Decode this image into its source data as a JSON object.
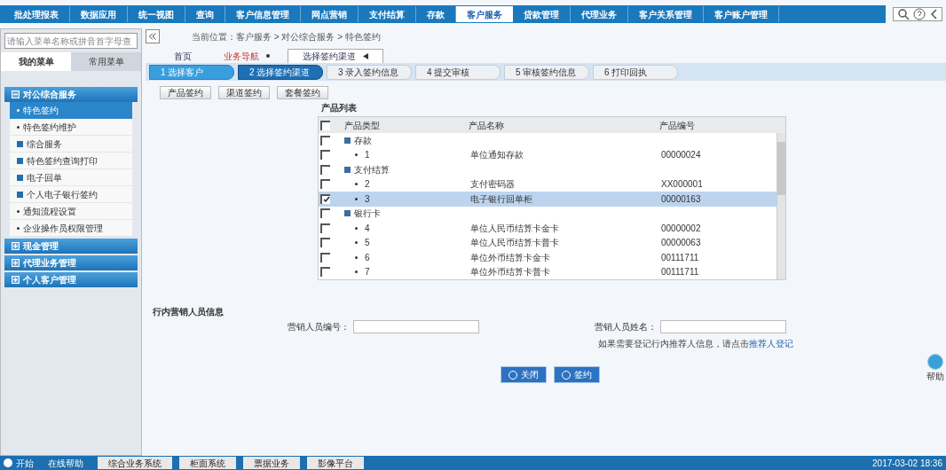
{
  "top_nav": [
    {
      "label": "批处理报表",
      "selected": false
    },
    {
      "label": "数据应用",
      "selected": false
    },
    {
      "label": "统一视图",
      "selected": false
    },
    {
      "label": "查询",
      "selected": false
    },
    {
      "label": "客户信息管理",
      "selected": false
    },
    {
      "label": "网点营销",
      "selected": false
    },
    {
      "label": "支付结算",
      "selected": false
    },
    {
      "label": "存款",
      "selected": false
    },
    {
      "label": "客户服务",
      "selected": true
    },
    {
      "label": "贷款管理",
      "selected": false
    },
    {
      "label": "代理业务",
      "selected": false
    },
    {
      "label": "客户关系管理",
      "selected": false
    },
    {
      "label": "客户账户管理",
      "selected": false
    }
  ],
  "sidebar": {
    "search_placeholder": "请输入菜单名称或拼音首字母查",
    "tabs": [
      {
        "label": "我的菜单",
        "selected": true
      },
      {
        "label": "常用菜单",
        "selected": false
      }
    ],
    "sections": [
      {
        "label": "对公综合服务",
        "expanded": true,
        "children": [
          {
            "label": "特色签约",
            "selected": true,
            "kind": "page"
          },
          {
            "label": "特色签约维护",
            "selected": false,
            "kind": "page"
          },
          {
            "label": "综合服务",
            "selected": false,
            "kind": "folder"
          },
          {
            "label": "特色签约查询打印",
            "selected": false,
            "kind": "folder"
          },
          {
            "label": "电子回单",
            "selected": false,
            "kind": "folder"
          },
          {
            "label": "个人电子银行签约",
            "selected": false,
            "kind": "folder"
          },
          {
            "label": "通知流程设置",
            "selected": false,
            "kind": "page"
          },
          {
            "label": "企业操作员权限管理",
            "selected": false,
            "kind": "page"
          }
        ]
      },
      {
        "label": "现金管理",
        "expanded": false
      },
      {
        "label": "代理业务管理",
        "expanded": false
      },
      {
        "label": "个人客户管理",
        "expanded": false
      }
    ]
  },
  "breadcrumb": "当前位置：客户服务 > 对公综合服务 > 特色签约",
  "page_tabs": [
    {
      "label": "首页",
      "selected": false,
      "kind": "plain"
    },
    {
      "label": "业务导航",
      "selected": false,
      "kind": "alert"
    },
    {
      "label": "选择签约渠道",
      "selected": true,
      "kind": "closable"
    }
  ],
  "steps": [
    {
      "label": "1  选择客户",
      "done": true,
      "selected": false
    },
    {
      "label": "2  选择签约渠道",
      "done": false,
      "selected": true
    },
    {
      "label": "3  录入签约信息",
      "done": false,
      "selected": false
    },
    {
      "label": "4  提交审核",
      "done": false,
      "selected": false
    },
    {
      "label": "5  审核签约信息",
      "done": false,
      "selected": false
    },
    {
      "label": "6  打印回执",
      "done": false,
      "selected": false
    }
  ],
  "sign_buttons": [
    "产品签约",
    "渠道签约",
    "套餐签约"
  ],
  "table": {
    "title": "产品列表",
    "columns": [
      "产品类型",
      "产品名称",
      "产品编号"
    ],
    "all_checked": false,
    "rows": [
      {
        "kind": "group",
        "type": "存款",
        "checked": false,
        "selected": false
      },
      {
        "kind": "item",
        "type": "1",
        "name": "单位通知存款",
        "code": "00000024",
        "checked": false,
        "selected": false
      },
      {
        "kind": "group",
        "type": "支付结算",
        "checked": false,
        "selected": false
      },
      {
        "kind": "item",
        "type": "2",
        "name": "支付密码器",
        "code": "XX000001",
        "checked": false,
        "selected": false
      },
      {
        "kind": "item",
        "type": "3",
        "name": "电子银行回单柜",
        "code": "00000163",
        "checked": true,
        "selected": true
      },
      {
        "kind": "group",
        "type": "银行卡",
        "checked": false,
        "selected": false
      },
      {
        "kind": "item",
        "type": "4",
        "name": "单位人民币结算卡金卡",
        "code": "00000002",
        "checked": false,
        "selected": false
      },
      {
        "kind": "item",
        "type": "5",
        "name": "单位人民币结算卡普卡",
        "code": "00000063",
        "checked": false,
        "selected": false
      },
      {
        "kind": "item",
        "type": "6",
        "name": "单位外币结算卡金卡",
        "code": "00111711",
        "checked": false,
        "selected": false
      },
      {
        "kind": "item",
        "type": "7",
        "name": "单位外币结算卡普卡",
        "code": "00111711",
        "checked": false,
        "selected": false
      }
    ]
  },
  "staff": {
    "title": "行内营销人员信息",
    "fields": [
      "营销人员编号：",
      "营销人员姓名："
    ],
    "note": "如果需要登记行内推荐人信息，请点击",
    "link": "推荐人登记"
  },
  "actions": [
    "关闭",
    "签约"
  ],
  "help": "帮助",
  "taskbar": {
    "start": "开始",
    "tasks": [
      "在线帮助",
      "综合业务系统",
      "柜面系统",
      "票据业务",
      "影像平台"
    ],
    "clock": "2017-03-02 18:36"
  }
}
